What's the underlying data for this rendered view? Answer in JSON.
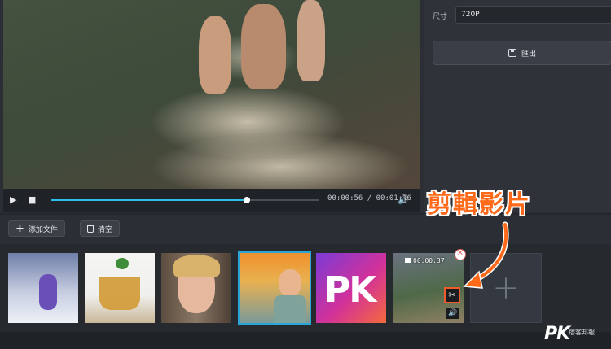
{
  "player": {
    "current_time": "00:00:56",
    "total_time": "00:01:16",
    "time_separator": " / ",
    "progress_fraction": 0.73
  },
  "settings": {
    "size_label": "尺寸",
    "size_value": "720P",
    "export_label": "匯出"
  },
  "toolbar": {
    "add_files_label": "添加文件",
    "clear_label": "清空"
  },
  "clips": [
    {
      "name": "snow-child"
    },
    {
      "name": "tea-cup"
    },
    {
      "name": "girl-portrait"
    },
    {
      "name": "sunset-child"
    },
    {
      "name": "pk-logo",
      "logo_text": "PK"
    },
    {
      "name": "cliff-jump",
      "duration": "00:00:37"
    }
  ],
  "annotation": {
    "callout_text": "剪輯影片"
  },
  "watermark": {
    "logo": "PK",
    "caption": "痞客邦報"
  },
  "colors": {
    "accent": "#2cc0e8",
    "callout": "#ff6a1a",
    "selected_outline": "#2aa6d6"
  }
}
